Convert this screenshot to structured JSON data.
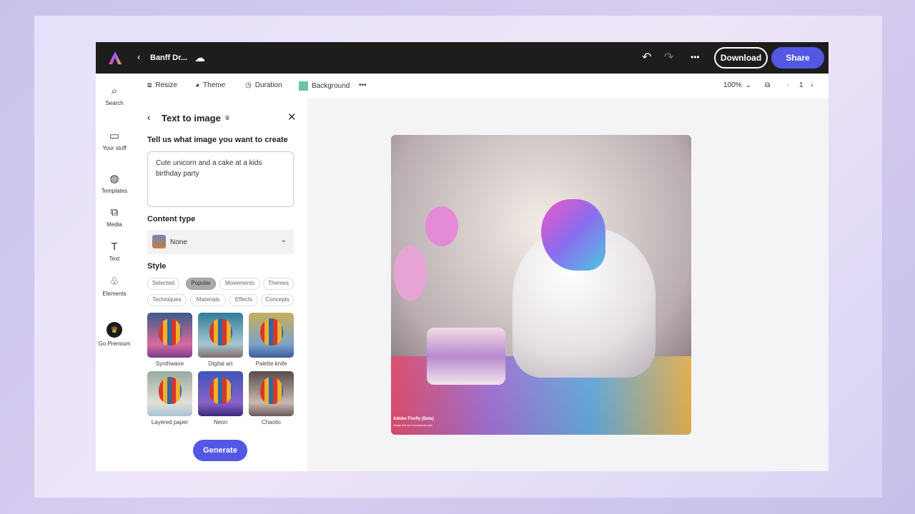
{
  "topbar": {
    "title": "Banff Dr...",
    "download": "Download",
    "share": "Share"
  },
  "toolbar": {
    "resize": "Resize",
    "theme": "Theme",
    "duration": "Duration",
    "background": "Background",
    "background_color": "#6cc4a8",
    "zoom": "100%",
    "page": "1"
  },
  "rail": [
    {
      "label": "Search",
      "icon": "search-icon"
    },
    {
      "label": "Your stuff",
      "icon": "folder-icon"
    },
    {
      "label": "Templates",
      "icon": "templates-icon"
    },
    {
      "label": "Media",
      "icon": "media-icon"
    },
    {
      "label": "Text",
      "icon": "text-icon"
    },
    {
      "label": "Elements",
      "icon": "elements-icon"
    },
    {
      "label": "Go Premium",
      "icon": "crown-icon"
    }
  ],
  "panel": {
    "title": "Text to image",
    "prompt_label": "Tell us what image you want to create",
    "prompt": "Cute unicorn and a cake at a kids birthday party",
    "content_type_label": "Content type",
    "content_type": "None",
    "style_label": "Style",
    "chips": [
      "Selected",
      "Popular",
      "Movements",
      "Themes",
      "Techniques",
      "Materials",
      "Effects",
      "Concepts"
    ],
    "selected_chip": "Popular",
    "styles": [
      "Synthwave",
      "Digital art",
      "Palette knife",
      "Layered paper",
      "Neon",
      "Chaotic"
    ],
    "generate": "Generate"
  },
  "canvas": {
    "watermark": "Adobe Firefly (Beta)",
    "watermark_sub": "Image Not for Commercial Use"
  },
  "colors": {
    "accent": "#5258e4",
    "topbar": "#1d1d1d"
  }
}
